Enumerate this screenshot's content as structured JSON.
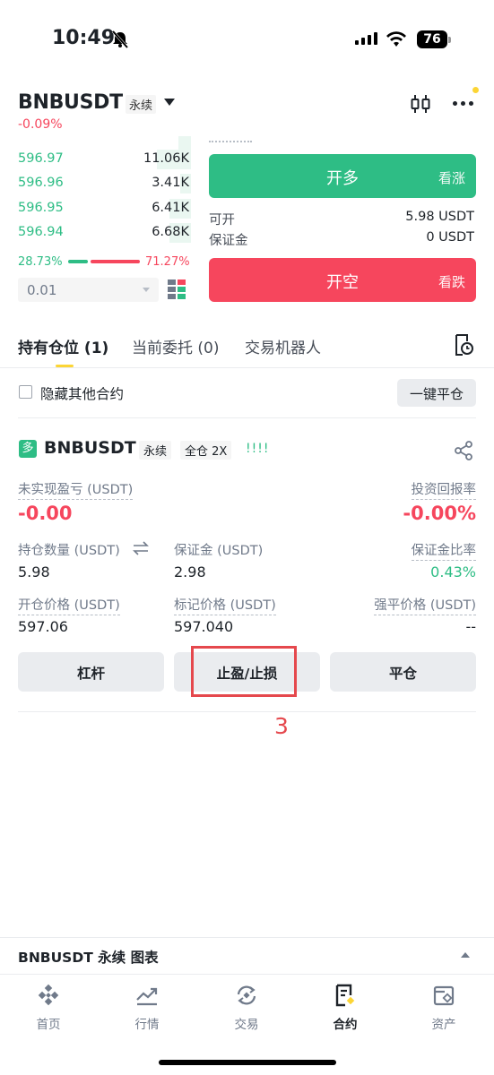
{
  "status_bar": {
    "time": "10:49",
    "battery": "76"
  },
  "header": {
    "symbol": "BNBUSDT",
    "contract_type": "永续",
    "change": "-0.09%"
  },
  "orderbook": {
    "bids": [
      {
        "price": "596.97",
        "qty": "11.06K",
        "depth": 0.2
      },
      {
        "price": "596.96",
        "qty": "3.41K",
        "depth": 0.06
      },
      {
        "price": "596.95",
        "qty": "6.41K",
        "depth": 0.12
      },
      {
        "price": "596.94",
        "qty": "6.68K",
        "depth": 0.12
      }
    ],
    "buy_ratio": "28.73%",
    "sell_ratio": "71.27%",
    "precision": "0.01"
  },
  "trade": {
    "long_label": "开多",
    "long_sub": "看涨",
    "short_label": "开空",
    "short_sub": "看跌",
    "available_label": "可开",
    "available_value": "5.98 USDT",
    "margin_label": "保证金",
    "margin_value": "0 USDT"
  },
  "tabs": {
    "positions": "持有仓位 (1)",
    "open_orders": "当前委托 (0)",
    "bots": "交易机器人"
  },
  "filter": {
    "hide_others": "隐藏其他合约",
    "close_all": "一键平仓"
  },
  "position": {
    "side": "多",
    "symbol": "BNBUSDT",
    "type": "永续",
    "margin_mode": "全仓 2X",
    "strength": "!!!!",
    "unrealized_pnl_label": "未实现盈亏 (USDT)",
    "unrealized_pnl": "-0.00",
    "roe_label": "投资回报率",
    "roe": "-0.00%",
    "size_label": "持仓数量 (USDT)",
    "size": "5.98",
    "margin_label": "保证金 (USDT)",
    "margin": "2.98",
    "margin_ratio_label": "保证金比率",
    "margin_ratio": "0.43%",
    "entry_label": "开仓价格 (USDT)",
    "entry": "597.06",
    "mark_label": "标记价格 (USDT)",
    "mark": "597.040",
    "liq_label": "强平价格 (USDT)",
    "liq": "--",
    "btn_leverage": "杠杆",
    "btn_tpsl": "止盈/止损",
    "btn_close": "平仓"
  },
  "annotation": {
    "step": "3"
  },
  "chart_bar": {
    "label": "BNBUSDT 永续 图表"
  },
  "nav": [
    {
      "label": "首页"
    },
    {
      "label": "行情"
    },
    {
      "label": "交易"
    },
    {
      "label": "合约"
    },
    {
      "label": "资产"
    }
  ],
  "colors": {
    "green": "#2ebd85",
    "red": "#f6465d",
    "yellow": "#fcd535"
  }
}
